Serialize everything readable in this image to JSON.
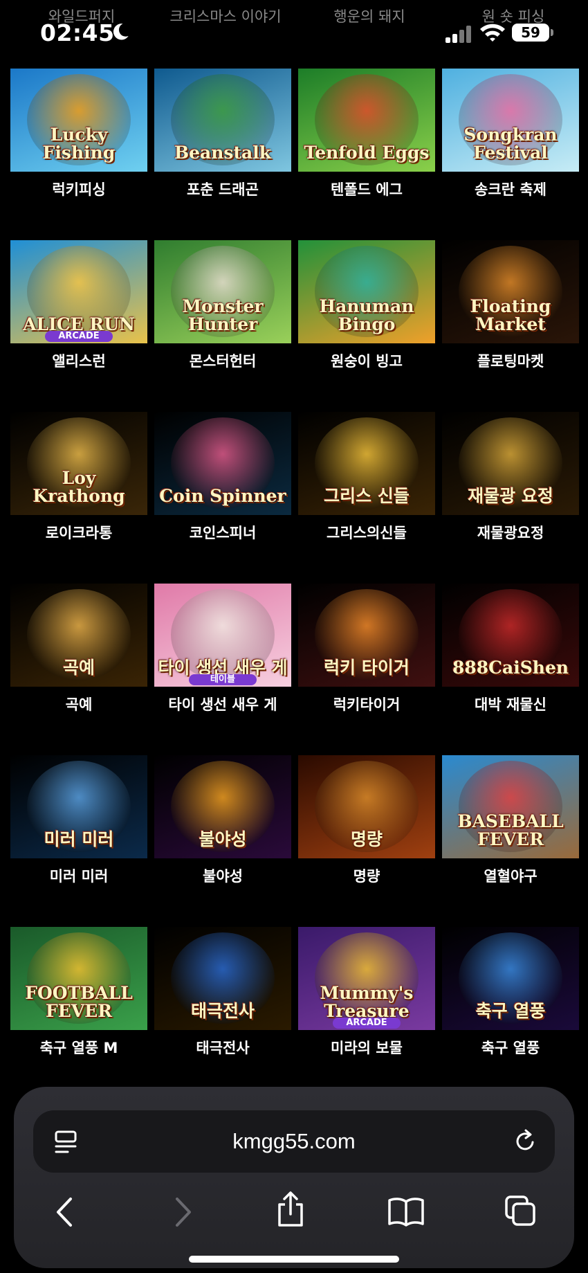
{
  "status_bar": {
    "time": "02:45",
    "battery": "59",
    "prev_titles": [
      "와일드퍼지",
      "크리스마스 이야기",
      "행운의 돼지",
      "원 숏 피싱"
    ]
  },
  "games": [
    {
      "name": "럭키피싱",
      "logo": "Lucky Fishing",
      "sub": "",
      "bg1": "#1b78c8",
      "bg2": "#6fd0f0",
      "art": "#f39c12"
    },
    {
      "name": "포춘 드래곤",
      "logo": "Beanstalk",
      "sub": "",
      "bg1": "#0f5a8f",
      "bg2": "#7fc6e0",
      "art": "#3c9a3c"
    },
    {
      "name": "텐폴드 에그",
      "logo": "Tenfold Eggs",
      "sub": "",
      "bg1": "#1c7d28",
      "bg2": "#8bd04a",
      "art": "#e24a2a"
    },
    {
      "name": "송크란 축제",
      "logo": "Songkran Festival",
      "sub": "",
      "bg1": "#4fb0e0",
      "bg2": "#c7ecf5",
      "art": "#e86aa0"
    },
    {
      "name": "앨리스런",
      "logo": "ALICE RUN",
      "sub": "ARCADE",
      "bg1": "#1f8fd6",
      "bg2": "#e9c24a",
      "art": "#f6c544"
    },
    {
      "name": "몬스터헌터",
      "logo": "Monster Hunter",
      "sub": "",
      "bg1": "#2f7d2f",
      "bg2": "#9ad05a",
      "art": "#e7ddd0"
    },
    {
      "name": "원숭이 빙고",
      "logo": "Hanuman Bingo",
      "sub": "",
      "bg1": "#22913a",
      "bg2": "#f0a02a",
      "art": "#2db0a0"
    },
    {
      "name": "플로팅마켓",
      "logo": "Floating Market",
      "sub": "",
      "bg1": "#000000",
      "bg2": "#2a1508",
      "art": "#e08a2a"
    },
    {
      "name": "로이크라통",
      "logo": "Loy Krathong",
      "sub": "",
      "bg1": "#000000",
      "bg2": "#3a2608",
      "art": "#e8b84a"
    },
    {
      "name": "코인스피너",
      "logo": "Coin Spinner",
      "sub": "",
      "bg1": "#000000",
      "bg2": "#0b2a40",
      "art": "#e05a8a"
    },
    {
      "name": "그리스의신들",
      "logo": "그리스 신들",
      "sub": "",
      "bg1": "#000000",
      "bg2": "#3a2405",
      "art": "#f0c03a"
    },
    {
      "name": "재물광요정",
      "logo": "재물광 요정",
      "sub": "",
      "bg1": "#000000",
      "bg2": "#2a1a05",
      "art": "#d8a83a"
    },
    {
      "name": "곡예",
      "logo": "곡예",
      "sub": "",
      "bg1": "#000000",
      "bg2": "#3a2405",
      "art": "#e8b04a"
    },
    {
      "name": "타이 생선 새우 게",
      "logo": "타이 생선 새우 게",
      "sub": "테이블",
      "bg1": "#e07aa8",
      "bg2": "#f7d0e0",
      "art": "#f0e6e0"
    },
    {
      "name": "럭키타이거",
      "logo": "럭키 타이거",
      "sub": "",
      "bg1": "#000000",
      "bg2": "#401010",
      "art": "#f08a2a"
    },
    {
      "name": "대박 재물신",
      "logo": "888CaiShen",
      "sub": "",
      "bg1": "#000000",
      "bg2": "#3a0a0a",
      "art": "#c82a2a"
    },
    {
      "name": "미러 미러",
      "logo": "미러 미러",
      "sub": "",
      "bg1": "#000000",
      "bg2": "#0b2a4a",
      "art": "#5aa0e0"
    },
    {
      "name": "불야성",
      "logo": "불야성",
      "sub": "",
      "bg1": "#000000",
      "bg2": "#2a0a3a",
      "art": "#f0a020"
    },
    {
      "name": "명량",
      "logo": "명량",
      "sub": "",
      "bg1": "#2a0a00",
      "bg2": "#a04010",
      "art": "#d88a2a"
    },
    {
      "name": "열혈야구",
      "logo": "BASEBALL FEVER",
      "sub": "",
      "bg1": "#2a8ad0",
      "bg2": "#9a6a3a",
      "art": "#e04040"
    },
    {
      "name": "축구 열풍 M",
      "logo": "FOOTBALL FEVER",
      "sub": "",
      "bg1": "#1a5a2a",
      "bg2": "#3aa04a",
      "art": "#f0c030"
    },
    {
      "name": "태극전사",
      "logo": "태극전사",
      "sub": "",
      "bg1": "#000000",
      "bg2": "#2a1a00",
      "art": "#2a6ad0"
    },
    {
      "name": "미라의 보물",
      "logo": "Mummy's Treasure",
      "sub": "ARCADE",
      "bg1": "#3a1a6a",
      "bg2": "#7a3aa0",
      "art": "#f0c030"
    },
    {
      "name": "축구 열풍",
      "logo": "축구 열풍",
      "sub": "",
      "bg1": "#000000",
      "bg2": "#1a0a3a",
      "art": "#3a8ae0"
    }
  ],
  "browser": {
    "url": "kmgg55.com"
  },
  "colors": {
    "background": "#000000",
    "toolbar": "#2a2a2f",
    "url_bar": "#18181b"
  }
}
